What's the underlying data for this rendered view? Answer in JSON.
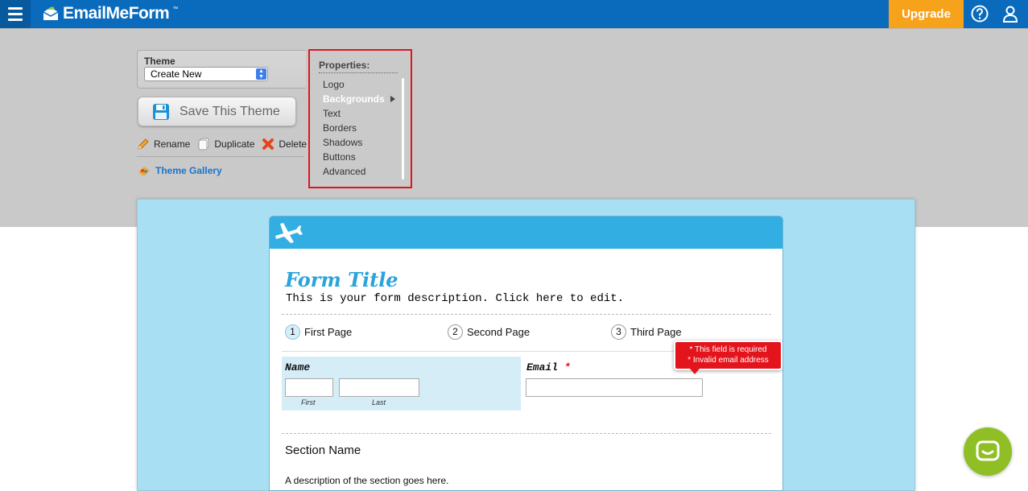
{
  "header": {
    "logo_text": "EmailMeForm",
    "logo_tm": "™",
    "upgrade_label": "Upgrade",
    "brand_color": "#0a6bbd",
    "upgrade_color": "#f7a21b"
  },
  "theme_panel": {
    "theme_label": "Theme",
    "theme_selected": "Create New",
    "save_label": "Save This Theme",
    "actions": [
      {
        "label": "Rename",
        "icon": "pencil-icon"
      },
      {
        "label": "Duplicate",
        "icon": "duplicate-icon"
      },
      {
        "label": "Delete",
        "icon": "delete-x-icon"
      }
    ],
    "gallery_label": "Theme Gallery"
  },
  "properties": {
    "title": "Properties:",
    "items": [
      "Logo",
      "Backgrounds",
      "Text",
      "Borders",
      "Shadows",
      "Buttons",
      "Advanced"
    ],
    "active": "Backgrounds",
    "highlight_color": "#e0141e"
  },
  "form": {
    "title": "Form Title",
    "description": "This is your form description. Click here to edit.",
    "steps": [
      {
        "num": "1",
        "label": "First Page"
      },
      {
        "num": "2",
        "label": "Second Page"
      },
      {
        "num": "3",
        "label": "Third Page"
      }
    ],
    "name_label": "Name",
    "first_label": "First",
    "last_label": "Last",
    "email_label": "Email",
    "required_mark": "*",
    "tooltip_line1": "* This field is required",
    "tooltip_line2": "* Invalid email address",
    "section_name": "Section Name",
    "section_desc": "A description of the section goes here.",
    "header_color": "#33aee2",
    "canvas_color": "#a8dff3"
  }
}
